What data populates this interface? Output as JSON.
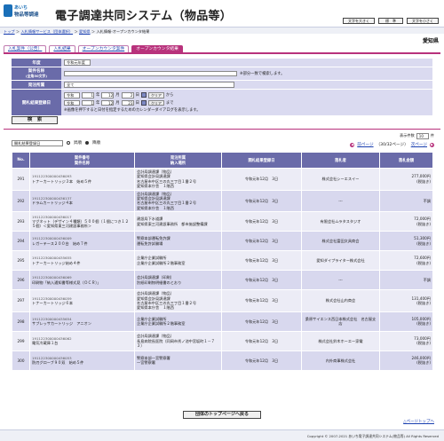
{
  "header": {
    "logo_line1": "あいち",
    "logo_line2": "物品等調達",
    "title": "電子調達共同システム（物品等）",
    "buttons": [
      "文字を大きく",
      "標　準",
      "文字を小さく"
    ]
  },
  "breadcrumb": {
    "items": [
      "トップ",
      "入札情報サービス（団体選択）",
      "愛知県",
      "入札情報-オープンカウンタ結果"
    ],
    "separator": "＞"
  },
  "region": "愛知県",
  "tabs": [
    "入札案件（公告）",
    "入札結果",
    "オープンカウンタ案件",
    "オープンカウンタ結果"
  ],
  "form": {
    "rows": [
      {
        "label": "年度",
        "value": "令和元年度"
      },
      {
        "label": "案件名称",
        "sublabel": "(全角50文字)",
        "note": "※部分一致で検索します。"
      },
      {
        "label": "発注所属",
        "value": "全て"
      },
      {
        "label": "開札結果登録日",
        "from": {
          "era": "令和",
          "y": "1",
          "m": "12",
          "d": "2"
        },
        "to": {
          "era": "令和",
          "y": "1",
          "m": "12",
          "d": "23"
        },
        "clear": "クリア",
        "from_suffix": "から",
        "to_suffix": "まで",
        "cal_note": "※画像を押下すると日付を指定するためのカレンダーダイアログを表示します。"
      }
    ],
    "y_label": "年",
    "m_label": "月",
    "d_label": "日"
  },
  "search_button": "検　索",
  "controls": {
    "sort_select": "開札結果登録日",
    "order_asc": "昇順",
    "order_desc": "降順",
    "count_label": "表示件数",
    "count_value": "10",
    "count_unit": "件",
    "prev": "前ページ",
    "page_info": "（30/32ページ）",
    "next": "次ページ"
  },
  "table": {
    "headers": [
      "No.",
      "案件番号\n案件名称",
      "発注所属\n納入場所",
      "開札結果登録日",
      "落札者",
      "落札金額"
    ],
    "rows": [
      {
        "no": "291",
        "case_no": "191122300000436093",
        "case_name": "トナーカートリッジ３本　始め５件",
        "dept": "会計局調達課（物品）\n愛知県会計局調達課\n名古屋市中区三の丸三丁目１番２号\n愛知県本庁舎　１階西",
        "date": "令和元年12月　3日",
        "winner": "株式会社シーエスイー",
        "amount": "277,000円\n(税抜き)"
      },
      {
        "no": "292",
        "case_no": "191122300000436137",
        "case_name": "ドラムカートリッジ４本",
        "dept": "会計局調達課（物品）\n愛知県会計局調達課\n名古屋市中区三の丸三丁目１番２号\n愛知県本庁舎　１階西",
        "date": "令和元年12月　3日",
        "winner": "---",
        "amount": "不調"
      },
      {
        "no": "293",
        "case_no": "191122300000436017",
        "case_name": "マグネット（デザイン４種類）５００個（１個につき１２５個）＜愛知県東三河建設事務所＞",
        "dept": "建設局下水道課\n愛知県東三河建設事務所　都市施設整備課",
        "date": "令和元年12月　3日",
        "winner": "有限会社ムラタスタジオ",
        "amount": "72,000円\n(税抜き)"
      },
      {
        "no": "294",
        "case_no": "191122300000436009",
        "case_name": "レガーテース２００台　始め７件",
        "dept": "警察本部運転免許課\n運転免許試験場",
        "date": "令和元年12月　3日",
        "winner": "株式会社富田文具商会",
        "amount": "51,300円\n(税抜き)"
      },
      {
        "no": "295",
        "case_no": "191122300000435655",
        "case_name": "トナーカートリッジ始め４件",
        "dept": "企業庁企業試験所\n企業庁企業試験所２階事務室",
        "date": "令和元年12月　3日",
        "winner": "愛知ダイプライター株式会社",
        "amount": "72,600円\n(税抜き)"
      },
      {
        "no": "296",
        "case_no": "191122300000436069",
        "case_name": "印刷物「納入通知書等様式見（ＯＣＲ）」",
        "dept": "会計局調達課（印刷）\n別紙印刷物明細書のとおり",
        "date": "令和元年12月　3日",
        "winner": "---",
        "amount": "不調"
      },
      {
        "no": "297",
        "case_no": "191122300000436059",
        "case_name": "トナーカートリッジ６本",
        "dept": "会計局調達課（物品）\n愛知県会計局調達課\n名古屋市中区三の丸三丁目１番２号\n愛知県本庁舎　１階西",
        "date": "令和元年12月　3日",
        "winner": "株式会社山内商会",
        "amount": "131,400円\n(税抜き)"
      },
      {
        "no": "298",
        "case_no": "191122300000435654",
        "case_name": "サブレッサカートリッジ　アニオン",
        "dept": "企業庁企業試験所\n企業庁企業試験所２階事務室",
        "date": "令和元年12月　3日",
        "winner": "桑原サイエンス西日本株式会社　名古屋支店",
        "amount": "105,000円\n(税抜き)"
      },
      {
        "no": "299",
        "case_no": "191122300000436062",
        "case_name": "電気冷蔵庫１台",
        "dept": "会計局調達課（物品）\n長島病院長医院（同岡市秀ノ池中宮坂町１－７３）",
        "date": "令和元年12月　3日",
        "winner": "株式会社鈴木ホーエー家電",
        "amount": "73,000円\n(税抜き)"
      },
      {
        "no": "300",
        "case_no": "191122300000436053",
        "case_name": "防刃グローブ９０双　始め５件",
        "dept": "警察本部一宮警察署\n一宮警察署",
        "date": "令和元年12月　3日",
        "winner": "内外商事株式会社",
        "amount": "246,000円\n(税抜き)"
      }
    ]
  },
  "back_button": "団体のトップページへ戻る",
  "top_link": "△ページトップへ",
  "footer": "Copyright © 2007-2021 あいち電子調達共同システム(物品等) All Rights Reserved"
}
